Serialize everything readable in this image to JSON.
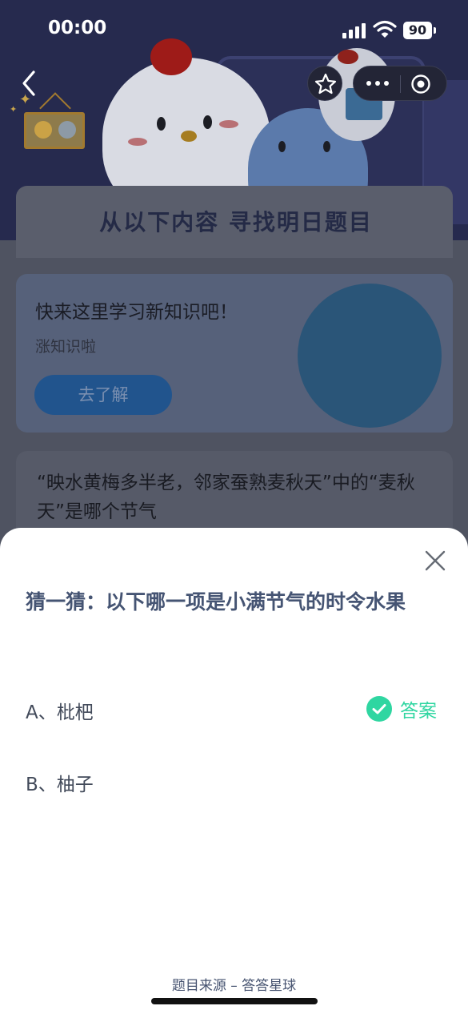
{
  "status_bar": {
    "time": "00:00",
    "battery": "90"
  },
  "nav": {
    "back_icon": "chevron-left-icon",
    "star_icon": "star-icon",
    "more_icon": "more-horizontal-icon",
    "target_icon": "target-icon"
  },
  "page": {
    "heading": "从以下内容 寻找明日题目",
    "learn_card": {
      "title": "快来这里学习新知识吧！",
      "subtitle": "涨知识啦",
      "button": "去了解"
    },
    "question_card": {
      "text": "“映水黄梅多半老，邻家蚕熟麦秋天”中的“麦秋天”是哪个节气"
    }
  },
  "sheet": {
    "title": "猜一猜：以下哪一项是小满节气的时令水果",
    "options": [
      {
        "label": "A、枇杷",
        "is_answer": true
      },
      {
        "label": "B、柚子",
        "is_answer": false
      }
    ],
    "answer_label": "答案",
    "source": "题目来源 – 答答星球"
  },
  "colors": {
    "accent_green": "#2fd6a1",
    "title_blue": "#455473",
    "overlay": "#4f5361"
  }
}
